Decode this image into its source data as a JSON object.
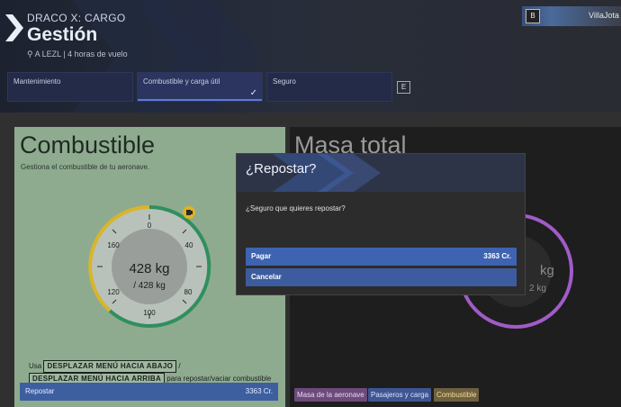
{
  "header": {
    "subtitle": "DRACO X: CARGO",
    "title": "Gestión",
    "location": "A LEZL | 4 horas de vuelo",
    "user_key": "B",
    "user_name": "VillaJota",
    "tabs_key": "E"
  },
  "tabs": [
    {
      "label": "Mantenimiento",
      "selected": false
    },
    {
      "label": "Combustible y carga útil",
      "selected": true
    },
    {
      "label": "Seguro",
      "selected": false
    }
  ],
  "fuel_panel": {
    "title": "Combustible",
    "description": "Gestiona el combustible de tu aeronave.",
    "gauge": {
      "current": "428 kg",
      "capacity": "/ 428 kg",
      "ticks": [
        "0",
        "40",
        "80",
        "100",
        "120",
        "160"
      ],
      "fill_fraction": 1.0
    },
    "instructions": {
      "prefix": "Usa",
      "key1": "DESPLAZAR MENÚ HACIA ABAJO",
      "sep": "/",
      "key2": "DESPLAZAR MENÚ HACIA ARRIBA",
      "suffix": "para repostar/vaciar combustible"
    },
    "refuel_label": "Repostar",
    "refuel_cost": "3363 Cr."
  },
  "mass_panel": {
    "title": "Masa total",
    "value_partial": "kg",
    "value_partial2": "2 kg",
    "legend": [
      {
        "label": "Masa de la aeronave",
        "color": "#9b59b6"
      },
      {
        "label": "Pasajeros y carga",
        "color": "#4a6fd6"
      },
      {
        "label": "Combustible",
        "color": "#c8a42a"
      }
    ]
  },
  "modal": {
    "title": "¿Repostar?",
    "question": "¿Seguro que quieres repostar?",
    "pay_label": "Pagar",
    "pay_cost": "3363 Cr.",
    "cancel_label": "Cancelar"
  },
  "colors": {
    "accent_blue": "#3e63b0",
    "fuel_yellow": "#d8b52a",
    "fuel_green": "#2f8f5f",
    "mass_purple": "#a05cc8"
  }
}
